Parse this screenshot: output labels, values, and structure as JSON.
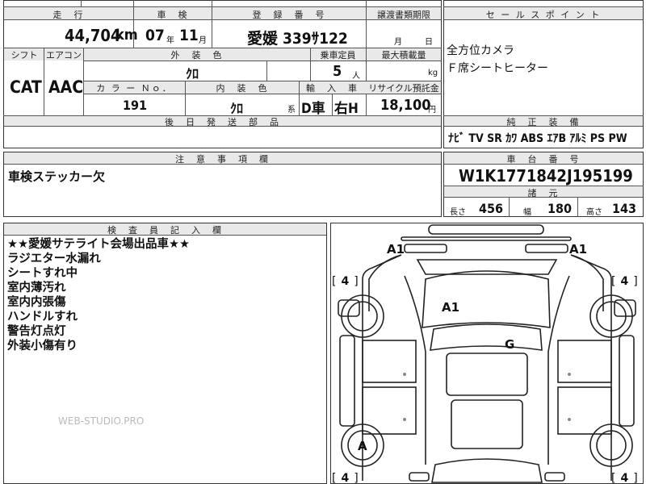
{
  "top_table": {
    "labels": {
      "mileage": "走　行",
      "inspection": "車　検",
      "registration": "登　録　番　号",
      "transfer": "譲渡書類期限",
      "shift": "シフト",
      "aircon": "エアコン",
      "exterior_color": "外　装　色",
      "capacity": "乗車定員",
      "max_load": "最大積載量",
      "color_no": "カ ラ ー Ｎｏ．",
      "interior_color": "内　装　色",
      "import": "輸　入　車",
      "recycle": "リサイクル預託金",
      "parts": "後　日　発　送　部　品"
    },
    "mileage_value": "44,704",
    "mileage_unit": "km",
    "inspection_year": "07",
    "inspection_year_unit": "年",
    "inspection_month": "11",
    "inspection_month_unit": "月",
    "registration_value": "愛媛 339ｻ122",
    "transfer_month_unit": "月",
    "transfer_day_unit": "日",
    "shift_value": "CAT",
    "aircon_value": "AAC",
    "exterior_color_value": "ｸﾛ",
    "capacity_value": "5",
    "capacity_unit": "人",
    "max_load_unit": "kg",
    "color_no_value": "191",
    "interior_color_value": "ｸﾛ",
    "interior_color_suffix": "系",
    "import_value_1": "D車",
    "import_value_2": "右H",
    "recycle_value": "18,100",
    "recycle_unit": "円"
  },
  "sales_points": {
    "title": "セ ー ル ス ポ イ ン ト",
    "lines": [
      "全方位カメラ",
      "Ｆ席シートヒーター"
    ]
  },
  "equipment": {
    "title": "純　正　装　備",
    "items": "ﾅﾋﾞ TV SR ｶﾜ ABS ｴｱB ｱﾙﾐ PS PW"
  },
  "notes": {
    "title": "注　意　事　項　欄",
    "text": "車検ステッカー欠"
  },
  "chassis": {
    "title": "車　台　番　号",
    "value": "W1K1771842J195199",
    "specs_title": "諸　元",
    "length_label": "長さ",
    "length_value": "456",
    "width_label": "幅",
    "width_value": "180",
    "height_label": "高さ",
    "height_value": "143"
  },
  "inspector": {
    "title": "検　査　員　記　入　欄",
    "lines": [
      "★★愛媛サテライト会場出品車★★",
      "ラジエター水漏れ",
      "シートすれ中",
      "室内薄汚れ",
      "室内内張傷",
      "ハンドルすれ",
      "警告灯点灯",
      "外装小傷有り"
    ],
    "watermark": "WEB-STUDIO.PRO"
  },
  "diagram": {
    "marks": {
      "front_left": "A1",
      "front_right": "A1",
      "roof": "A1",
      "body": "G",
      "rear_wheel": "A"
    },
    "tire_label_open": "[",
    "tire_value": "4",
    "tire_label_close": "]"
  }
}
